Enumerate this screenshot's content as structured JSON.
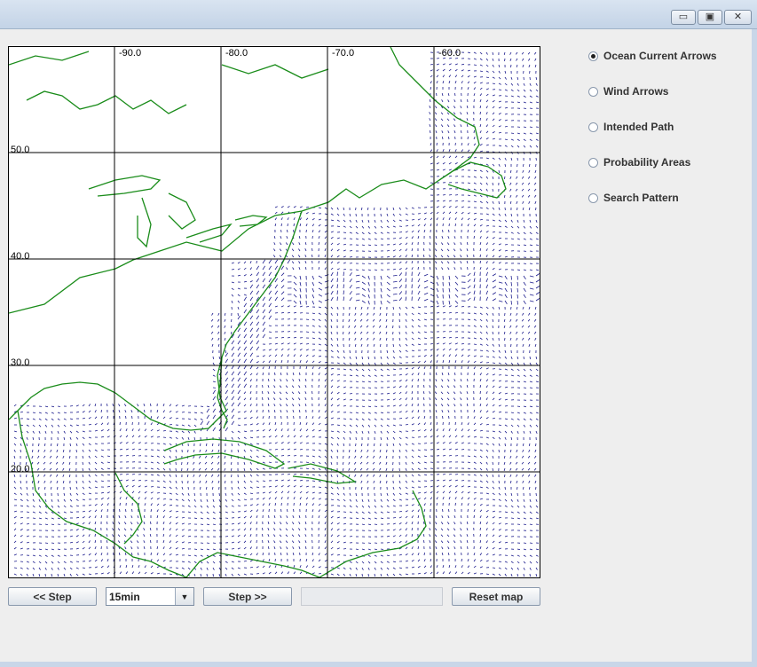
{
  "window": {
    "minimize_glyph": "▭",
    "maximize_glyph": "▣",
    "close_glyph": "✕"
  },
  "map": {
    "lon_labels": [
      "-90.0",
      "-80.0",
      "-70.0",
      "-60.0"
    ],
    "lat_labels": [
      "50.0",
      "40.0",
      "30.0",
      "20.0"
    ],
    "colors": {
      "land": "#1a8c1a",
      "arrows": "#1a1a8c",
      "grid": "#000000"
    }
  },
  "radio_options": [
    {
      "label": "Ocean Current Arrows",
      "checked": true
    },
    {
      "label": "Wind Arrows",
      "checked": false
    },
    {
      "label": "Intended Path",
      "checked": false
    },
    {
      "label": "Probability Areas",
      "checked": false
    },
    {
      "label": "Search Pattern",
      "checked": false
    }
  ],
  "controls": {
    "step_back_label": "<< Step",
    "interval_value": "15min",
    "step_forward_label": "Step >>",
    "reset_label": "Reset map",
    "progress": 0
  }
}
